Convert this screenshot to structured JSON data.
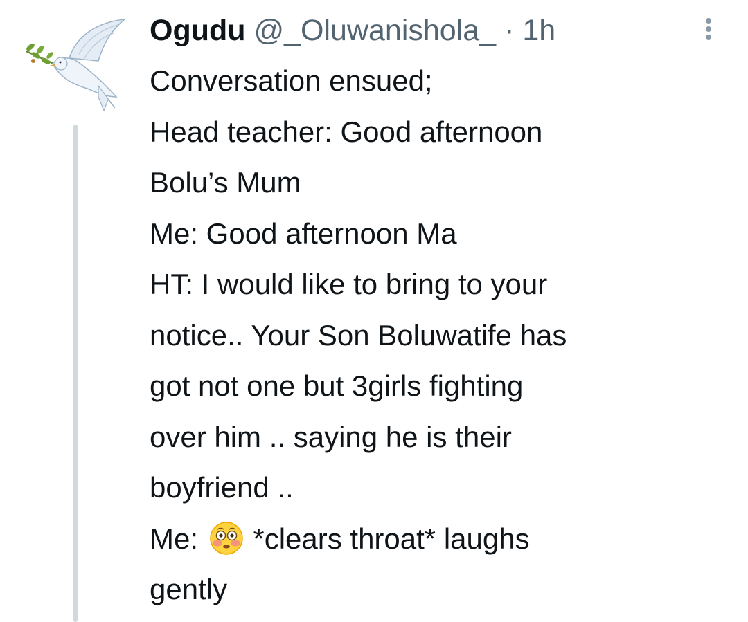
{
  "tweet": {
    "author": {
      "display_name": "Ogudu",
      "handle": "@_Oluwanishola_",
      "separator": "·",
      "time_ago": "1h"
    },
    "lines": [
      "Conversation ensued;",
      "Head teacher: Good afternoon",
      "Bolu’s Mum",
      "Me: Good afternoon Ma",
      "HT: I would like to bring to your",
      "notice.. Your Son Boluwatife has",
      "got not one but 3girls fighting",
      "over him .. saying he is their",
      "boyfriend .."
    ],
    "last_lines": {
      "me_prefix": "Me:",
      "emoji": "flushed-face",
      "after_emoji": "*clears throat* laughs",
      "final": "gently"
    }
  },
  "colors": {
    "text": "#0f1419",
    "secondary": "#536471",
    "thread_line": "#cfd9de",
    "dove": "#e4edf6",
    "olive_branch": "#5a8a2e"
  }
}
